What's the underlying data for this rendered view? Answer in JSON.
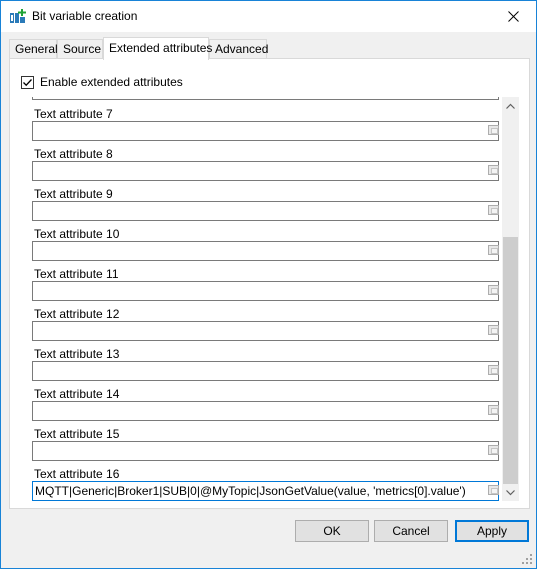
{
  "window": {
    "title": "Bit variable creation"
  },
  "tabs": [
    {
      "label": "General",
      "active": false
    },
    {
      "label": "Source",
      "active": false
    },
    {
      "label": "Extended attributes",
      "active": true
    },
    {
      "label": "Advanced",
      "active": false
    }
  ],
  "extended": {
    "enable_label": "Enable extended attributes",
    "enabled": true,
    "attributes": [
      {
        "label": "Text attribute 7",
        "value": ""
      },
      {
        "label": "Text attribute 8",
        "value": ""
      },
      {
        "label": "Text attribute 9",
        "value": ""
      },
      {
        "label": "Text attribute 10",
        "value": ""
      },
      {
        "label": "Text attribute 11",
        "value": ""
      },
      {
        "label": "Text attribute 12",
        "value": ""
      },
      {
        "label": "Text attribute 13",
        "value": ""
      },
      {
        "label": "Text attribute 14",
        "value": ""
      },
      {
        "label": "Text attribute 15",
        "value": ""
      },
      {
        "label": "Text attribute 16",
        "value": "MQTT|Generic|Broker1|SUB|0|@MyTopic|JsonGetValue(value, 'metrics[0].value')"
      }
    ]
  },
  "buttons": {
    "ok": "OK",
    "cancel": "Cancel",
    "apply": "Apply"
  },
  "colors": {
    "accent": "#0078d7",
    "window_border": "#1883d7"
  }
}
